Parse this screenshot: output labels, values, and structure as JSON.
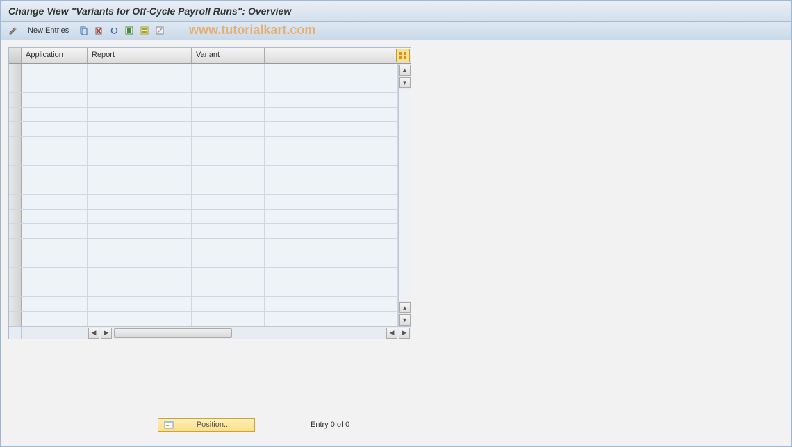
{
  "title": "Change View \"Variants for Off-Cycle Payroll Runs\": Overview",
  "toolbar": {
    "new_entries": "New Entries"
  },
  "watermark": "www.tutorialkart.com",
  "grid": {
    "columns": {
      "application": "Application",
      "report": "Report",
      "variant": "Variant"
    },
    "row_count": 18,
    "rows": []
  },
  "footer": {
    "position_label": "Position...",
    "entry_status": "Entry 0 of 0"
  }
}
